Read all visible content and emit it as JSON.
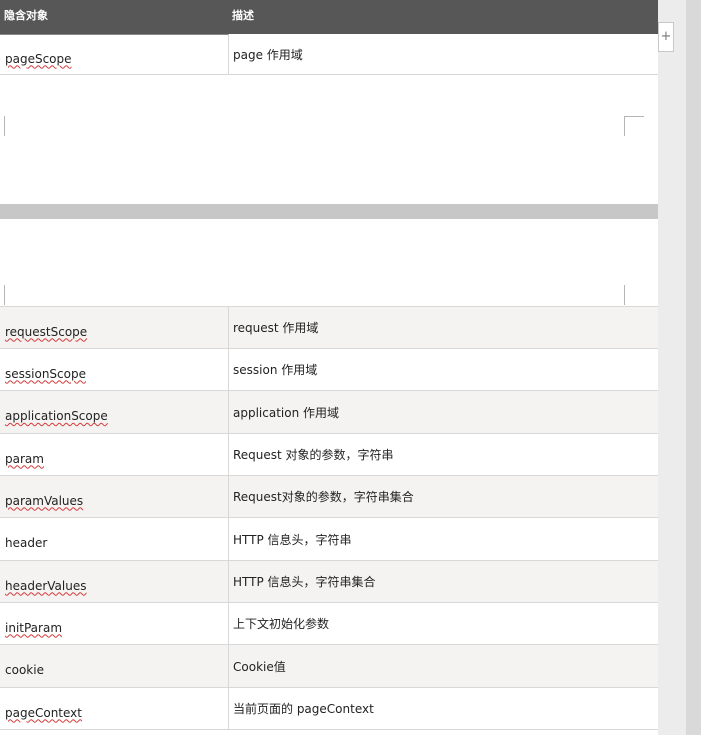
{
  "table": {
    "headers": [
      "隐含对象",
      "描述"
    ],
    "rows": [
      {
        "name": "pageScope",
        "desc": "page 作用域",
        "underline": true
      },
      {
        "name": "requestScope",
        "desc": "request 作用域",
        "underline": true
      },
      {
        "name": "sessionScope",
        "desc": "session 作用域",
        "underline": true
      },
      {
        "name": "applicationScope",
        "desc": "application 作用域",
        "underline": true
      },
      {
        "name": "param",
        "desc": "Request 对象的参数，字符串",
        "underline": true
      },
      {
        "name": "paramValues",
        "desc": "Request对象的参数，字符串集合",
        "underline": true
      },
      {
        "name": "header",
        "desc": "HTTP 信息头，字符串",
        "underline": false
      },
      {
        "name": "headerValues",
        "desc": "HTTP 信息头，字符串集合",
        "underline": true
      },
      {
        "name": "initParam",
        "desc": "上下文初始化参数",
        "underline": true
      },
      {
        "name": "cookie",
        "desc": "Cookie值",
        "underline": false
      },
      {
        "name": "pageContext",
        "desc": "当前页面的 pageContext",
        "underline": true
      }
    ]
  },
  "add_column_glyph": "+"
}
